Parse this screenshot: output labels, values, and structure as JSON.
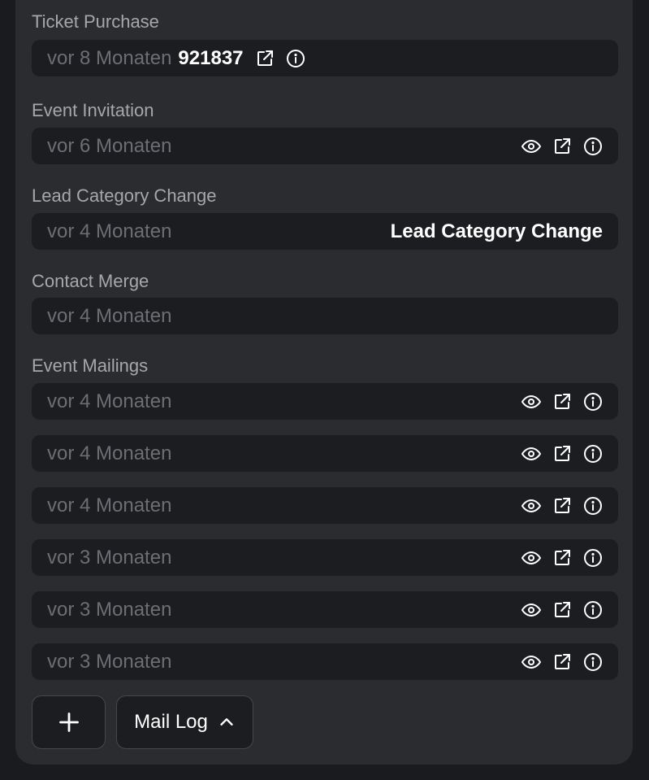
{
  "sections": {
    "ticket_purchase": {
      "label": "Ticket Purchase",
      "time": "vor 8 Monaten",
      "value": "921837"
    },
    "event_invitation": {
      "label": "Event Invitation",
      "time": "vor 6 Monaten"
    },
    "lead_category_change": {
      "label": "Lead Category Change",
      "time": "vor 4 Monaten",
      "value": "Lead Category Change"
    },
    "contact_merge": {
      "label": "Contact Merge",
      "time": "vor 4 Monaten"
    },
    "event_mailings": {
      "label": "Event Mailings",
      "items": [
        {
          "time": "vor 4 Monaten"
        },
        {
          "time": "vor 4 Monaten"
        },
        {
          "time": "vor 4 Monaten"
        },
        {
          "time": "vor 3 Monaten"
        },
        {
          "time": "vor 3 Monaten"
        },
        {
          "time": "vor 3 Monaten"
        }
      ]
    }
  },
  "footer": {
    "add_icon": "plus-icon",
    "mail_log_label": "Mail Log",
    "mail_log_icon": "chevron-up-icon"
  },
  "icons": {
    "view": "eye-icon",
    "open": "external-link-icon",
    "info": "info-icon"
  },
  "colors": {
    "panel": "#2b2c30",
    "row": "#1c1d20",
    "muted_text": "#6d6e73",
    "label_text": "#a6a7ab"
  }
}
